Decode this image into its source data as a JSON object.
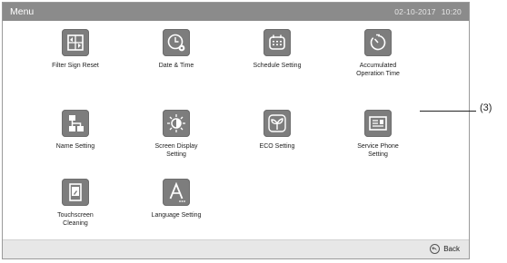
{
  "header": {
    "title": "Menu",
    "date": "02-10-2017",
    "time": "10:20"
  },
  "menu": [
    {
      "label": "Filter Sign Reset",
      "icon": "filter-reset-icon"
    },
    {
      "label": "Date & Time",
      "icon": "clock-gear-icon"
    },
    {
      "label": "Schedule Setting",
      "icon": "calendar-icon"
    },
    {
      "label": "Accumulated\nOperation Time",
      "icon": "timer-icon"
    },
    {
      "label": "Name Setting",
      "icon": "hierarchy-icon"
    },
    {
      "label": "Screen Display\nSetting",
      "icon": "brightness-icon"
    },
    {
      "label": "ECO Setting",
      "icon": "leaf-icon"
    },
    {
      "label": "Service Phone\nSetting",
      "icon": "contact-card-icon"
    },
    {
      "label": "Touchscreen\nCleaning",
      "icon": "touchscreen-icon"
    },
    {
      "label": "Language Setting",
      "icon": "language-icon"
    }
  ],
  "footer": {
    "back_label": "Back"
  },
  "annotation": {
    "callout": "(3)"
  },
  "colors": {
    "titlebar": "#8b8b8b",
    "tile": "#7d7d7d",
    "footer": "#e7e7e7"
  }
}
